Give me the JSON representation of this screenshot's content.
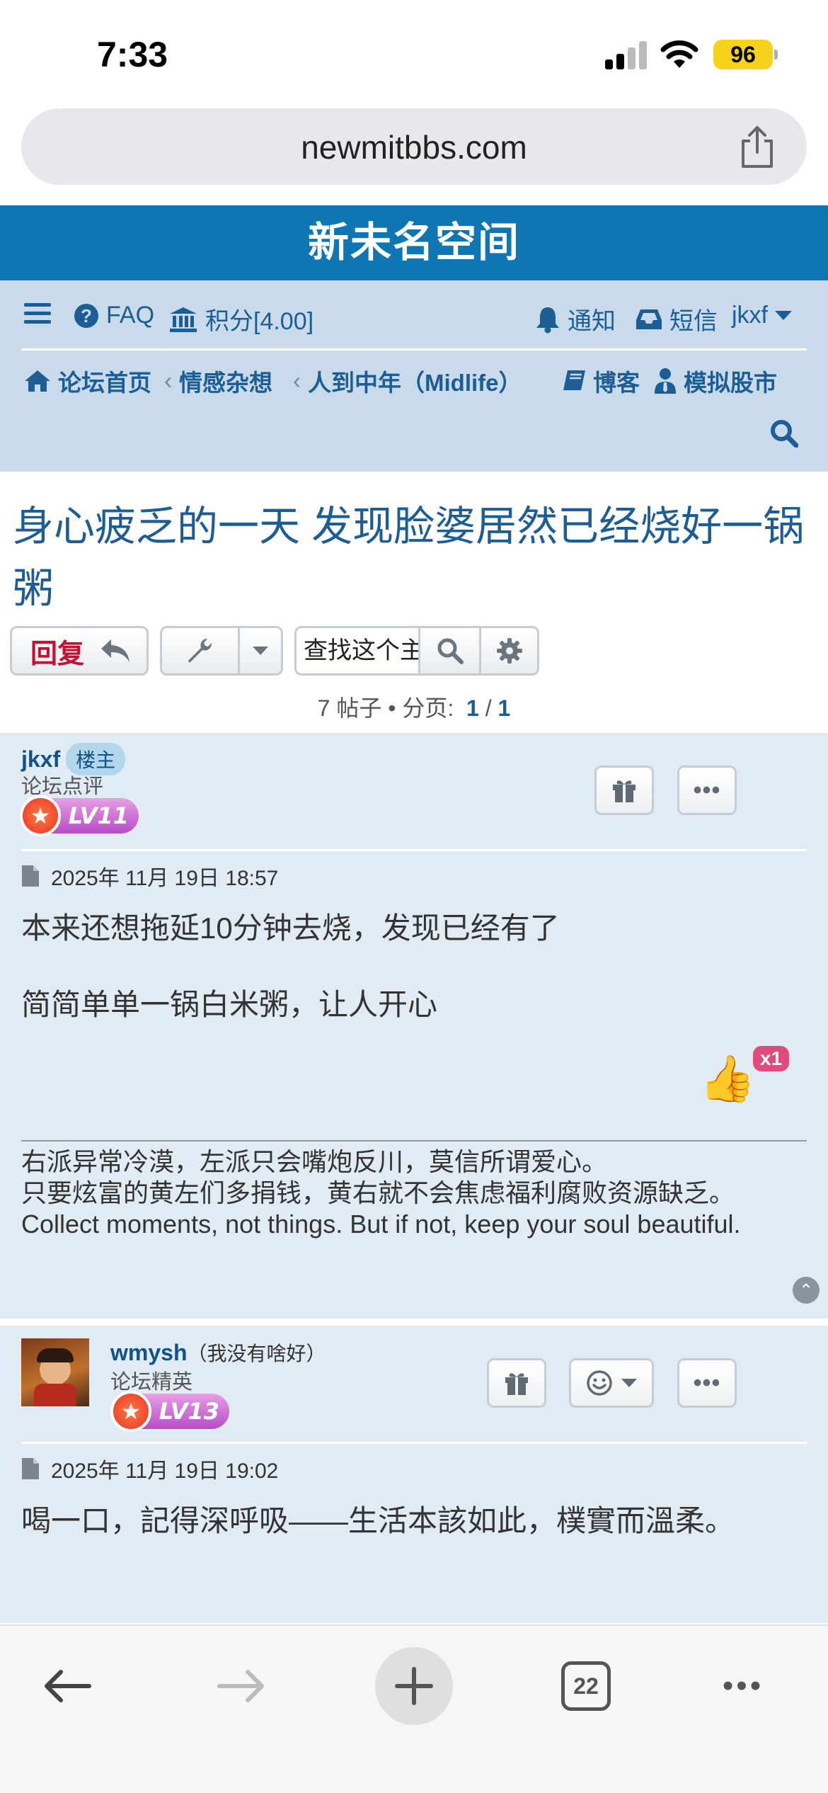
{
  "status": {
    "time": "7:33",
    "battery": "96"
  },
  "browser": {
    "url": "newmitbbs.com",
    "tab_count": "22"
  },
  "site": {
    "title": "新未名空间"
  },
  "nav": {
    "faq": "FAQ",
    "points": "积分[4.00]",
    "notify": "通知",
    "messages": "短信",
    "user": "jkxf",
    "breadcrumb": [
      "论坛首页",
      "情感杂想",
      "人到中年（Midlife）"
    ],
    "blog": "博客",
    "stock": "模拟股市"
  },
  "topic": {
    "title": "身心疲乏的一天 发现脸婆居然已经烧好一锅粥",
    "reply_label": "回复",
    "search_placeholder": "查找这个主题",
    "post_count": "7 帖子",
    "bullet": "•",
    "page_label": "分页:",
    "page_current": "1",
    "page_sep": "/",
    "page_total": "1"
  },
  "posts": [
    {
      "author": "jkxf",
      "op_badge": "楼主",
      "rank": "论坛点评",
      "level": "LV11",
      "date": "2025年 11月 19日 18:57",
      "lines": [
        "本来还想拖延10分钟去烧，发现已经有了",
        "简简单单一锅白米粥，让人开心"
      ],
      "reaction_count": "x1",
      "signature": [
        "右派异常冷漠，左派只会嘴炮反川，莫信所谓爱心。",
        "只要炫富的黄左们多捐钱，黄右就不会焦虑福利腐败资源缺乏。",
        "Collect moments, not things. But if not, keep your soul beautiful."
      ]
    },
    {
      "author": "wmysh",
      "author_note": "（我没有啥好）",
      "rank": "论坛精英",
      "level": "LV13",
      "date": "2025年 11月 19日 19:02",
      "lines": [
        "喝一口，記得深呼吸——生活本該如此，樸實而溫柔。"
      ]
    }
  ],
  "colors": {
    "brand": "#0f76b4",
    "nav_bg": "#c9dbeb",
    "post_bg": "#e1ebf3",
    "link": "#105289",
    "reply": "#c4112f"
  }
}
